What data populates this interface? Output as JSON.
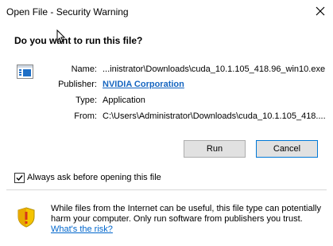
{
  "window": {
    "title": "Open File - Security Warning"
  },
  "prompt": {
    "question": "Do you want to run this file?"
  },
  "file_info": {
    "name_label": "Name:",
    "name_value": "...inistrator\\Downloads\\cuda_10.1.105_418.96_win10.exe",
    "publisher_label": "Publisher:",
    "publisher_value": "NVIDIA Corporation",
    "type_label": "Type:",
    "type_value": "Application",
    "from_label": "From:",
    "from_value": "C:\\Users\\Administrator\\Downloads\\cuda_10.1.105_418...."
  },
  "buttons": {
    "run": "Run",
    "cancel": "Cancel"
  },
  "options": {
    "always_ask_label": "Always ask before opening this file",
    "always_ask_checked": true
  },
  "warning": {
    "text": "While files from the Internet can be useful, this file type can potentially harm your computer. Only run software from publishers you trust.",
    "risk_link": "What's the risk?"
  },
  "icons": {
    "file": "application-file-icon",
    "shield": "security-shield-icon",
    "close": "close-icon",
    "cursor": "mouse-cursor-icon"
  },
  "colors": {
    "link": "#1565c0",
    "shield_yellow": "#f5c400",
    "shield_red": "#d6341c",
    "file_icon_blue": "#1e6fc6"
  }
}
